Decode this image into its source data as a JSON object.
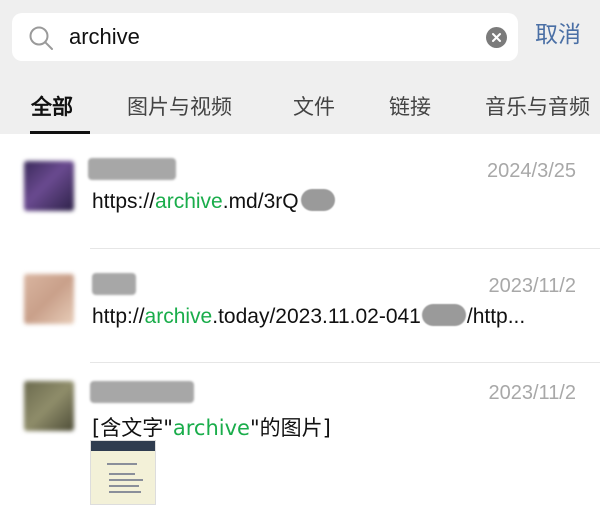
{
  "search": {
    "query": "archive",
    "cancel_label": "取消"
  },
  "tabs": [
    "全部",
    "图片与视频",
    "文件",
    "链接",
    "音乐与音频"
  ],
  "results": [
    {
      "date": "2024/3/25",
      "prefix": "https://",
      "highlight": "archive",
      "suffix": ".md/3rQ",
      "after": ""
    },
    {
      "date": "2023/11/2",
      "prefix": "http://",
      "highlight": "archive",
      "suffix": ".today/2023.11.02-041",
      "after": "/http..."
    },
    {
      "date": "2023/11/2",
      "prefix": "[含文字\"",
      "highlight": "archive",
      "suffix": "\"的图片]",
      "after": ""
    }
  ],
  "colors": {
    "highlight": "#1aad4b",
    "cancel": "#4a6fa5",
    "header_bg": "#efefef"
  }
}
